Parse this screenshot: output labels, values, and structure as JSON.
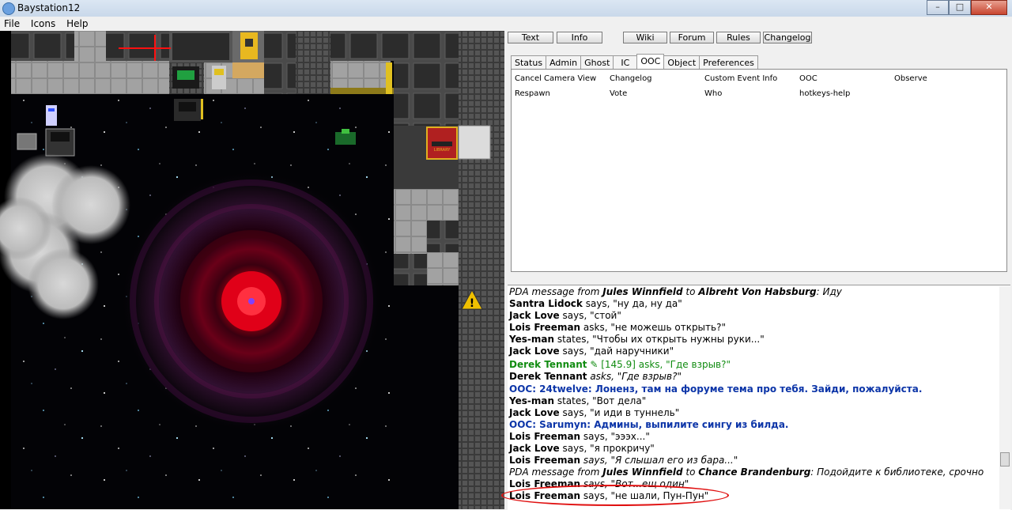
{
  "window": {
    "title": "Baystation12",
    "minimize": "–",
    "maximize": "□",
    "close": "✕"
  },
  "menu": [
    "File",
    "Icons",
    "Help"
  ],
  "toolbar": [
    "Text",
    "Info",
    "Wiki",
    "Forum",
    "Rules",
    "Changelog"
  ],
  "tabs": [
    "Status",
    "Admin",
    "Ghost",
    "IC",
    "OOC",
    "Object",
    "Preferences"
  ],
  "active_tab": "OOC",
  "verbs": [
    "Cancel Camera View",
    "Changelog",
    "Custom Event Info",
    "OOC",
    "Observe",
    "Respawn",
    "Vote",
    "Who",
    "hotkeys-help"
  ],
  "chat": [
    {
      "type": "pda",
      "prefix": "PDA message from ",
      "from": "Jules Winnfield",
      "mid": " to ",
      "to": "Albreht Von Habsburg",
      "text": ": Иду"
    },
    {
      "type": "say",
      "name": "Santra Lidock",
      "text": " says, \"ну да, ну да\""
    },
    {
      "type": "say",
      "name": "Jack Love",
      "text": " says, \"стой\""
    },
    {
      "type": "say",
      "name": "Lois Freeman",
      "text": " asks, \"не можешь открыть?\""
    },
    {
      "type": "say",
      "name": "Yes-man",
      "text": " states, \"Чтобы их открыть нужны руки...\""
    },
    {
      "type": "say",
      "name": "Jack Love",
      "text": " says, \"дай наручники\""
    },
    {
      "type": "radio",
      "name": "Derek Tennant",
      "text": " ✎ [145.9] asks, \"Где взрыв?\""
    },
    {
      "type": "italic",
      "name": "Derek Tennant",
      "text": " asks, \"Где взрыв?\""
    },
    {
      "type": "ooc",
      "text": "OOC: 24twelve: Лоненз, там на форуме тема про тебя. Зайди, пожалуйста."
    },
    {
      "type": "say",
      "name": "Yes-man",
      "text": " states, \"Вот дела\""
    },
    {
      "type": "say",
      "name": "Jack Love",
      "text": " says, \"и иди в туннель\""
    },
    {
      "type": "ooc",
      "text": "OOC: Sarumyn: Админы, выпилите сингу из билда."
    },
    {
      "type": "say",
      "name": "Lois Freeman",
      "text": " says, \"эээх...\""
    },
    {
      "type": "say",
      "name": "Jack Love",
      "text": " says, \"я прокричу\""
    },
    {
      "type": "italic",
      "name": "Lois Freeman",
      "text": " says, \"Я слышал его из бара...\""
    },
    {
      "type": "pda",
      "prefix": "PDA message from ",
      "from": "Jules Winnfield",
      "mid": " to ",
      "to": "Chance Brandenburg",
      "text": ": Подойдите к библиотеке, срочно"
    },
    {
      "type": "italic",
      "name": "Lois Freeman",
      "text": " says, \"Вот...ещ один\""
    },
    {
      "type": "say",
      "name": "Lois Freeman",
      "text": " says, \"не шали, Пун-Пун\""
    }
  ],
  "sign": "!",
  "library_sign": "LIBRARY"
}
